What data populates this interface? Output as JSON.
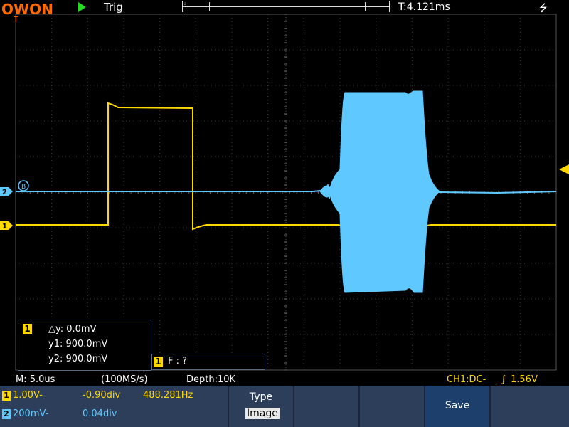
{
  "header": {
    "logo": "OWON",
    "run_state_icon": "play-triangle",
    "trigger_status": "Trig",
    "trigger_time": "T:4.121ms",
    "usb_icon": "usb-icon"
  },
  "cursor_measure": {
    "channel": "1",
    "dy": "△y: 0.0mV",
    "y1": "y1: 900.0mV",
    "y2": "y2: 900.0mV"
  },
  "frequency_measure": {
    "channel": "1",
    "text": "F :   ?"
  },
  "status_bar": {
    "timebase": "M: 5.0us",
    "sample_rate": "(100MS/s)",
    "depth": "Depth:10K",
    "trigger_info": "CH1:DC-",
    "trigger_level": "1.56V"
  },
  "channels": [
    {
      "number": "1",
      "scale": "1.00V-",
      "offset": "-0.90div",
      "frequency": "488.281Hz",
      "color": "#ffd800"
    },
    {
      "number": "2",
      "scale": "200mV-",
      "offset": "0.04div",
      "color": "#5ec8ff"
    }
  ],
  "menu": {
    "type_label": "Type",
    "type_value": "Image",
    "save_label": "Save"
  },
  "marker_labels": {
    "trigger_pos": "T",
    "ch2_marker": "2",
    "ch1_marker": "1",
    "cursor_circle": "B"
  },
  "colors": {
    "ch1": "#ffd800",
    "ch2": "#5ec8ff",
    "grid": "#3a3a3a",
    "panel": "#2c3e5a",
    "accent": "#ff6a00"
  }
}
